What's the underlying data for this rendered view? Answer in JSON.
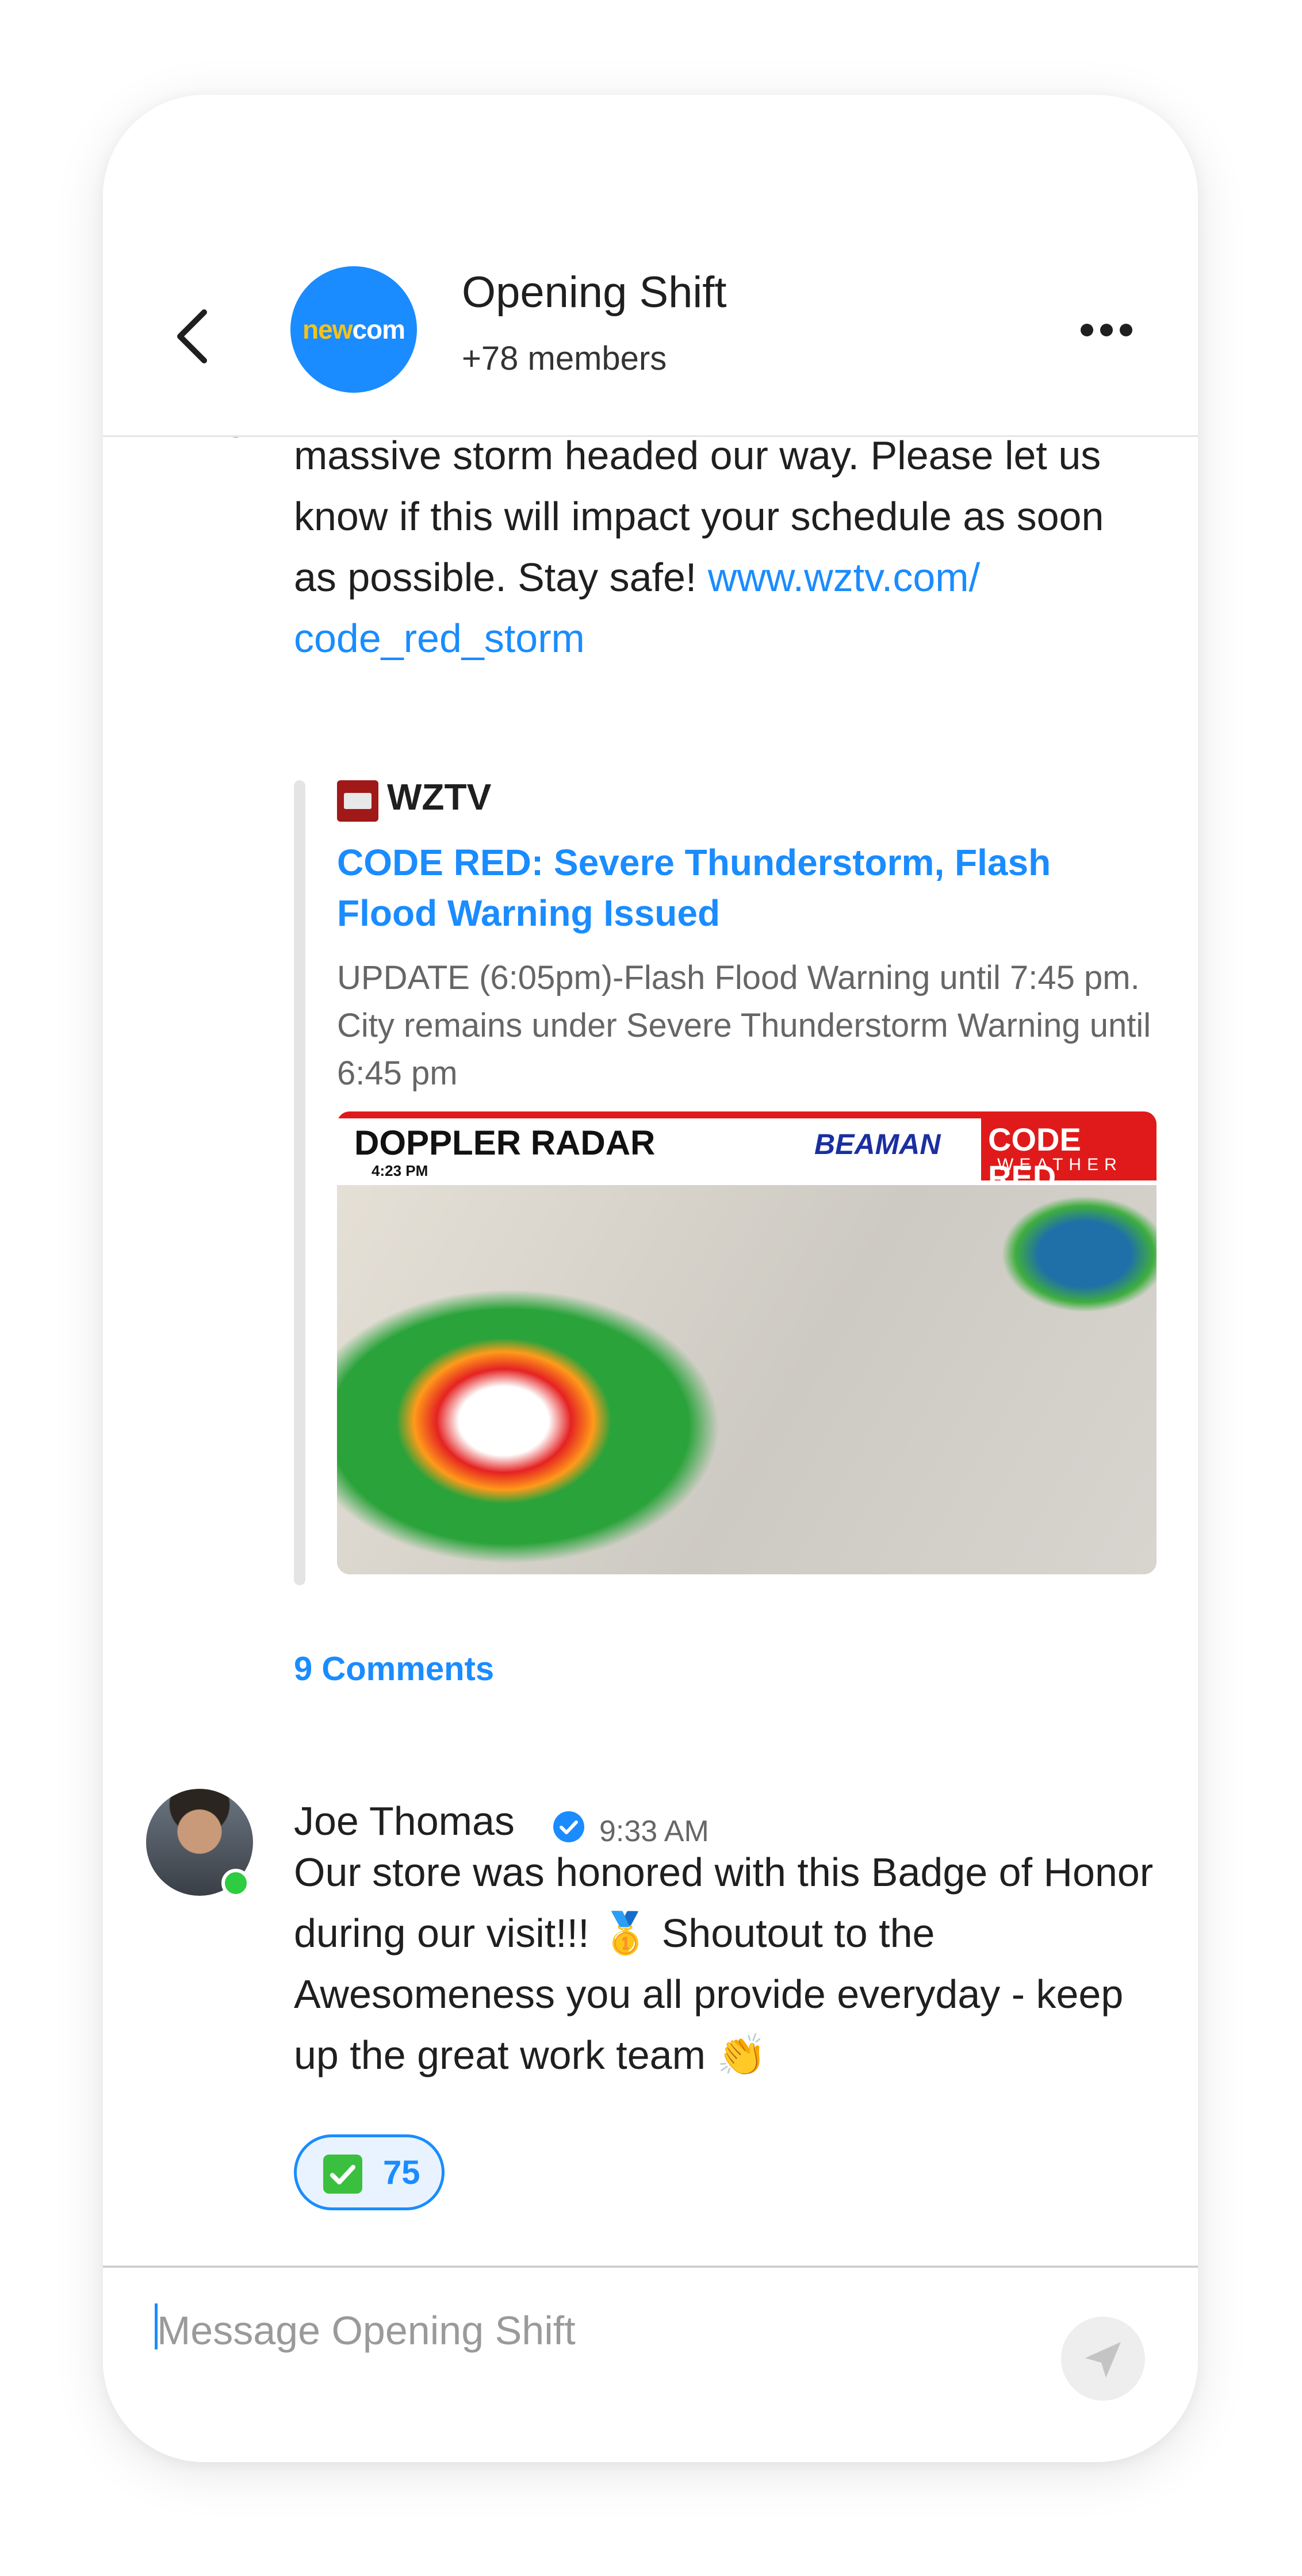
{
  "header": {
    "title": "Opening Shift",
    "members": "+78 members",
    "logo_text_a": "new",
    "logo_text_b": "com"
  },
  "posts": [
    {
      "text_partial": "massive storm headed our way. Please let us know if this will impact your schedule as soon as possible. Stay safe! ",
      "link_text": "www.wztv.com/ code_red_storm",
      "link_preview": {
        "source": "WZTV",
        "title": "CODE RED: Severe Thunderstorm, Flash Flood Warning Issued",
        "description": "UPDATE (6:05pm)-Flash Flood Warning until 7:45 pm. City remains under Severe Thunderstorm Warning until 6:45 pm",
        "image": {
          "label": "DOPPLER RADAR",
          "time": "4:23 PM",
          "brand": "BEAMAN",
          "badge_line1": "CODE RED",
          "badge_line2": "WEATHER"
        }
      },
      "comments_label": "9 Comments"
    },
    {
      "author": "Joe Thomas",
      "time": "9:33 AM",
      "text": "Our store was honored with this Badge of Honor during our visit!!! 🥇 Shoutout to the Awesomeness you all provide everyday - keep up the great work team 👏",
      "reaction": {
        "emoji": "check-mark-button",
        "count": "75"
      }
    }
  ],
  "composer": {
    "placeholder": "Message Opening Shift"
  },
  "colors": {
    "accent": "#1a8cff",
    "online": "#2ecc40",
    "alert_red": "#e01a1a"
  },
  "icons": [
    "chevron-left-icon",
    "more-dots-icon",
    "verified-badge-icon",
    "send-icon",
    "check-mark-button-icon"
  ]
}
